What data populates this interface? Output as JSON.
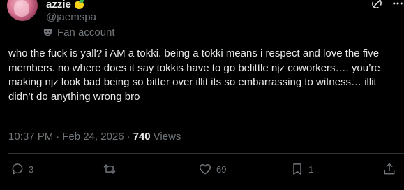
{
  "author": {
    "display_name": "azzie",
    "name_emoji": "lemon",
    "handle": "@jaemspa",
    "badge_label": "Fan account",
    "badge_icon": "fan-mask-icon"
  },
  "tweet": {
    "text": "who the fuck is yall? i AM a tokki. being a tokki means i respect and love the five members. no where does it say tokkis have to go belittle njz coworkers…. you’re making njz look bad being so bitter over illit its so embarrassing to witness… illit didn’t do anything wrong bro",
    "time": "10:37 PM",
    "separator": "·",
    "date": "Feb 24, 2026",
    "views_count": "740",
    "views_label": "Views"
  },
  "actions": {
    "replies": "3",
    "retweets": "",
    "likes": "69",
    "bookmarks": "1"
  },
  "colors": {
    "background": "#000000",
    "text_primary": "#e7e9ea",
    "text_secondary": "#71767b",
    "divider": "#2f3336"
  }
}
